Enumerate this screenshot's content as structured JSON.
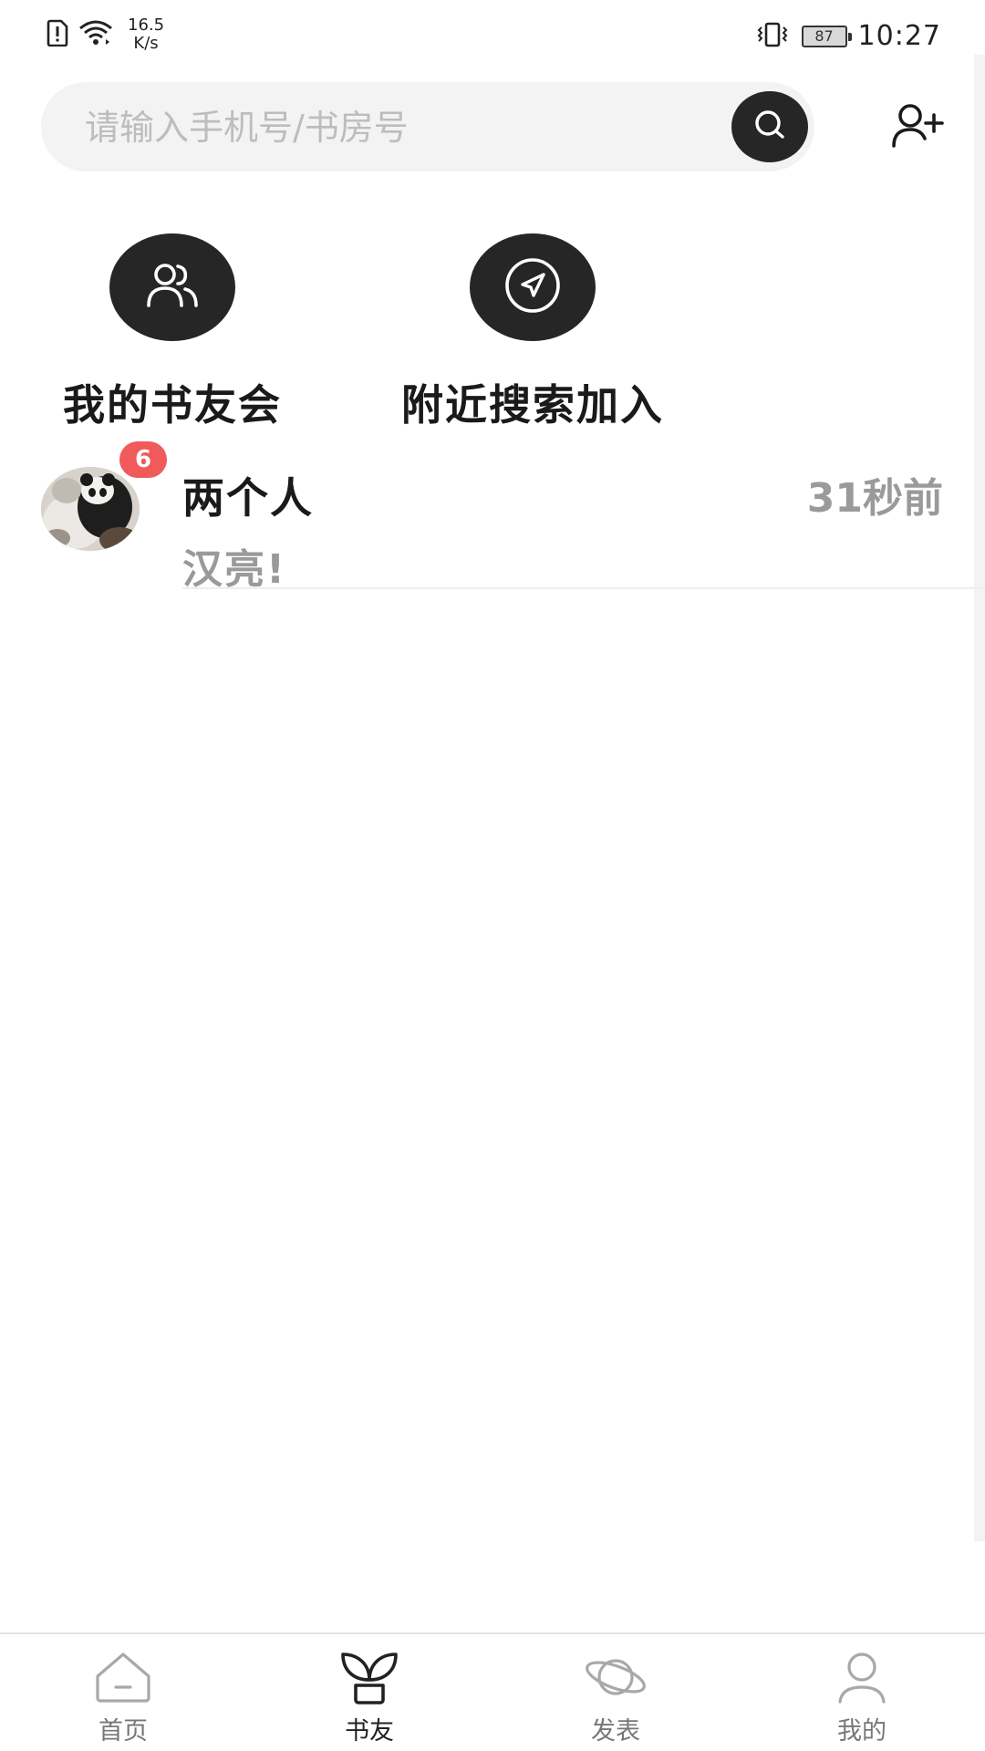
{
  "status_bar": {
    "net_speed_value": "16.5",
    "net_speed_unit": "K/s",
    "battery": "87",
    "time": "10:27",
    "icons": [
      "sim-alert-icon",
      "wifi-icon",
      "vibrate-icon",
      "battery-icon"
    ]
  },
  "search": {
    "placeholder": "请输入手机号/书房号",
    "value": "",
    "icon": "search-icon",
    "add_friend_icon": "add-user-icon"
  },
  "quick_actions": [
    {
      "label": "我的书友会",
      "icon": "people-icon"
    },
    {
      "label": "附近搜索加入",
      "icon": "location-arrow-icon"
    }
  ],
  "conversations": [
    {
      "name": "两个人",
      "time": "31秒前",
      "message": "汉亮!",
      "unread": "6",
      "avatar": "panda-photo"
    }
  ],
  "bottom_nav": {
    "active": "书友",
    "items": [
      {
        "label": "首页",
        "icon": "home-icon"
      },
      {
        "label": "书友",
        "icon": "sprout-icon"
      },
      {
        "label": "发表",
        "icon": "planet-icon"
      },
      {
        "label": "我的",
        "icon": "user-icon"
      }
    ]
  },
  "colors": {
    "dark_accent": "#262626",
    "badge": "#f05a5a",
    "muted_text": "#9a9a9a",
    "search_bg": "#f3f3f3"
  }
}
